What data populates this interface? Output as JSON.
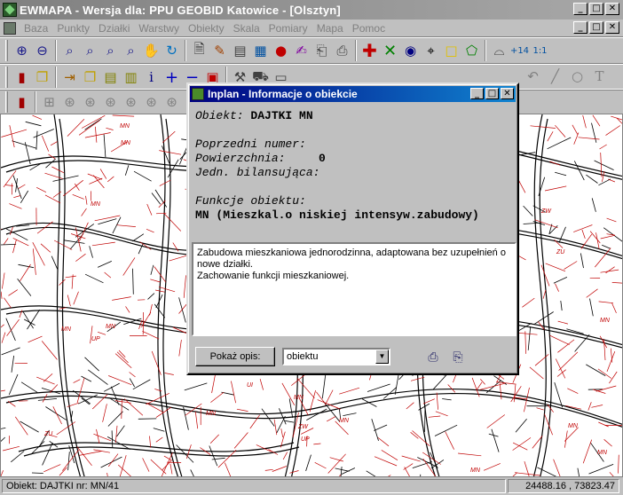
{
  "app": {
    "title": "EWMAPA - Wersja dla: PPU GEOBID Katowice - [Olsztyn]",
    "window_buttons": {
      "minimize": "_",
      "maximize": "□",
      "close": "✕"
    }
  },
  "menu": {
    "items": [
      "Baza",
      "Punkty",
      "Działki",
      "Warstwy",
      "Obiekty",
      "Skala",
      "Pomiary",
      "Mapa",
      "Pomoc"
    ]
  },
  "toolbar1": [
    "zoom-in",
    "zoom-out",
    "zoom-window",
    "zoom-prev",
    "zoom-extent",
    "zoom-mag",
    "pan-hand",
    "refresh",
    "print-preview",
    "brush",
    "select-layer",
    "image",
    "colors",
    "edit-tool",
    "stamp",
    "printer",
    "add-point",
    "delete",
    "snap",
    "target",
    "rectangle",
    "polygon",
    "measure",
    "renumber",
    "scale-1-1"
  ],
  "toolbar2": [
    "door",
    "copy",
    "export",
    "copy2",
    "table",
    "table2",
    "info",
    "plus",
    "minus",
    "frame",
    "tool",
    "car",
    "screen",
    "grid",
    "grid2",
    "grid3",
    "undo",
    "redo",
    "info2",
    "line",
    "polyline",
    "circle",
    "arc",
    "text",
    "hatch"
  ],
  "toolbar3": [
    "exit",
    "d1",
    "d2",
    "d3",
    "d4",
    "d5",
    "d6",
    "d7",
    "d8"
  ],
  "map": {
    "labels": [
      "MN",
      "MN",
      "MN",
      "MN",
      "ZW",
      "MN",
      "MN",
      "ZU",
      "UP",
      "MN",
      "MN",
      "MN",
      "ZU",
      "MN",
      "ZU",
      "MN",
      "MN",
      "ZW",
      "MN",
      "MN",
      "UP",
      "MN",
      "MN",
      "MN",
      "ZU",
      "MN",
      "UI",
      "MN"
    ]
  },
  "dialog": {
    "title": "Inplan - Informacje o obiekcie",
    "object_label": "Obiekt:",
    "object_value": "DAJTKI MN",
    "prev_number_label": "Poprzedni numer:",
    "area_label": "Powierzchnia:",
    "area_value": "0",
    "unit_label": "Jedn. bilansująca:",
    "functions_label": "Funkcje obiektu:",
    "function_value": "MN (Mieszkal.o niskiej intensyw.zabudowy)",
    "description_lines": [
      "Zabudowa mieszkaniowa jednorodzinna, adaptowana bez uzupełnień o",
      "nowe działki.",
      "Zachowanie funkcji mieszkaniowej."
    ],
    "show_button": "Pokaż opis:",
    "select_value": "obiektu"
  },
  "status": {
    "object": "Obiekt: DAJTKI   nr: MN/41",
    "coords": "24488.16 , 73823.47"
  }
}
